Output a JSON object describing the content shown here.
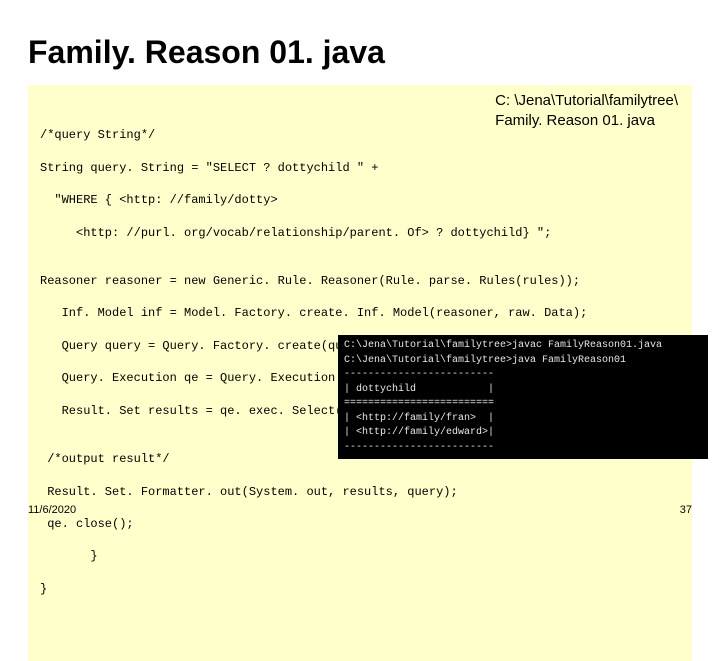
{
  "title": "Family. Reason 01. java",
  "overlay": {
    "line1": "C: \\Jena\\Tutorial\\familytree\\",
    "line2": "Family. Reason 01. java"
  },
  "code": {
    "l1": "/*query String*/",
    "l2": "String query. String = \"SELECT ? dottychild \" +",
    "l3": "  \"WHERE { <http: //family/dotty>",
    "l4": "     <http: //purl. org/vocab/relationship/parent. Of> ? dottychild} \";",
    "l5": "",
    "l6": "Reasoner reasoner = new Generic. Rule. Reasoner(Rule. parse. Rules(rules));",
    "l7": "   Inf. Model inf = Model. Factory. create. Inf. Model(reasoner, raw. Data);",
    "l8": "   Query query = Query. Factory. create(query. String);",
    "l9": "   Query. Execution qe = Query. Execution. Factory. create(query, inf);",
    "l10": "   Result. Set results = qe. exec. Select();",
    "l11": "",
    "l12": " /*output result*/",
    "l13": " Result. Set. Formatter. out(System. out, results, query);",
    "l14": " qe. close();",
    "l15": "       }",
    "l16": "}"
  },
  "terminal": {
    "t1": "C:\\Jena\\Tutorial\\familytree>javac FamilyReason01.java",
    "t2": "C:\\Jena\\Tutorial\\familytree>java FamilyReason01",
    "t3": "-------------------------",
    "t4": "| dottychild            |",
    "t5": "=========================",
    "t6": "| <http://family/fran>  |",
    "t7": "| <http://family/edward>|",
    "t8": "-------------------------"
  },
  "footer": {
    "date": "11/6/2020",
    "page": "37"
  }
}
